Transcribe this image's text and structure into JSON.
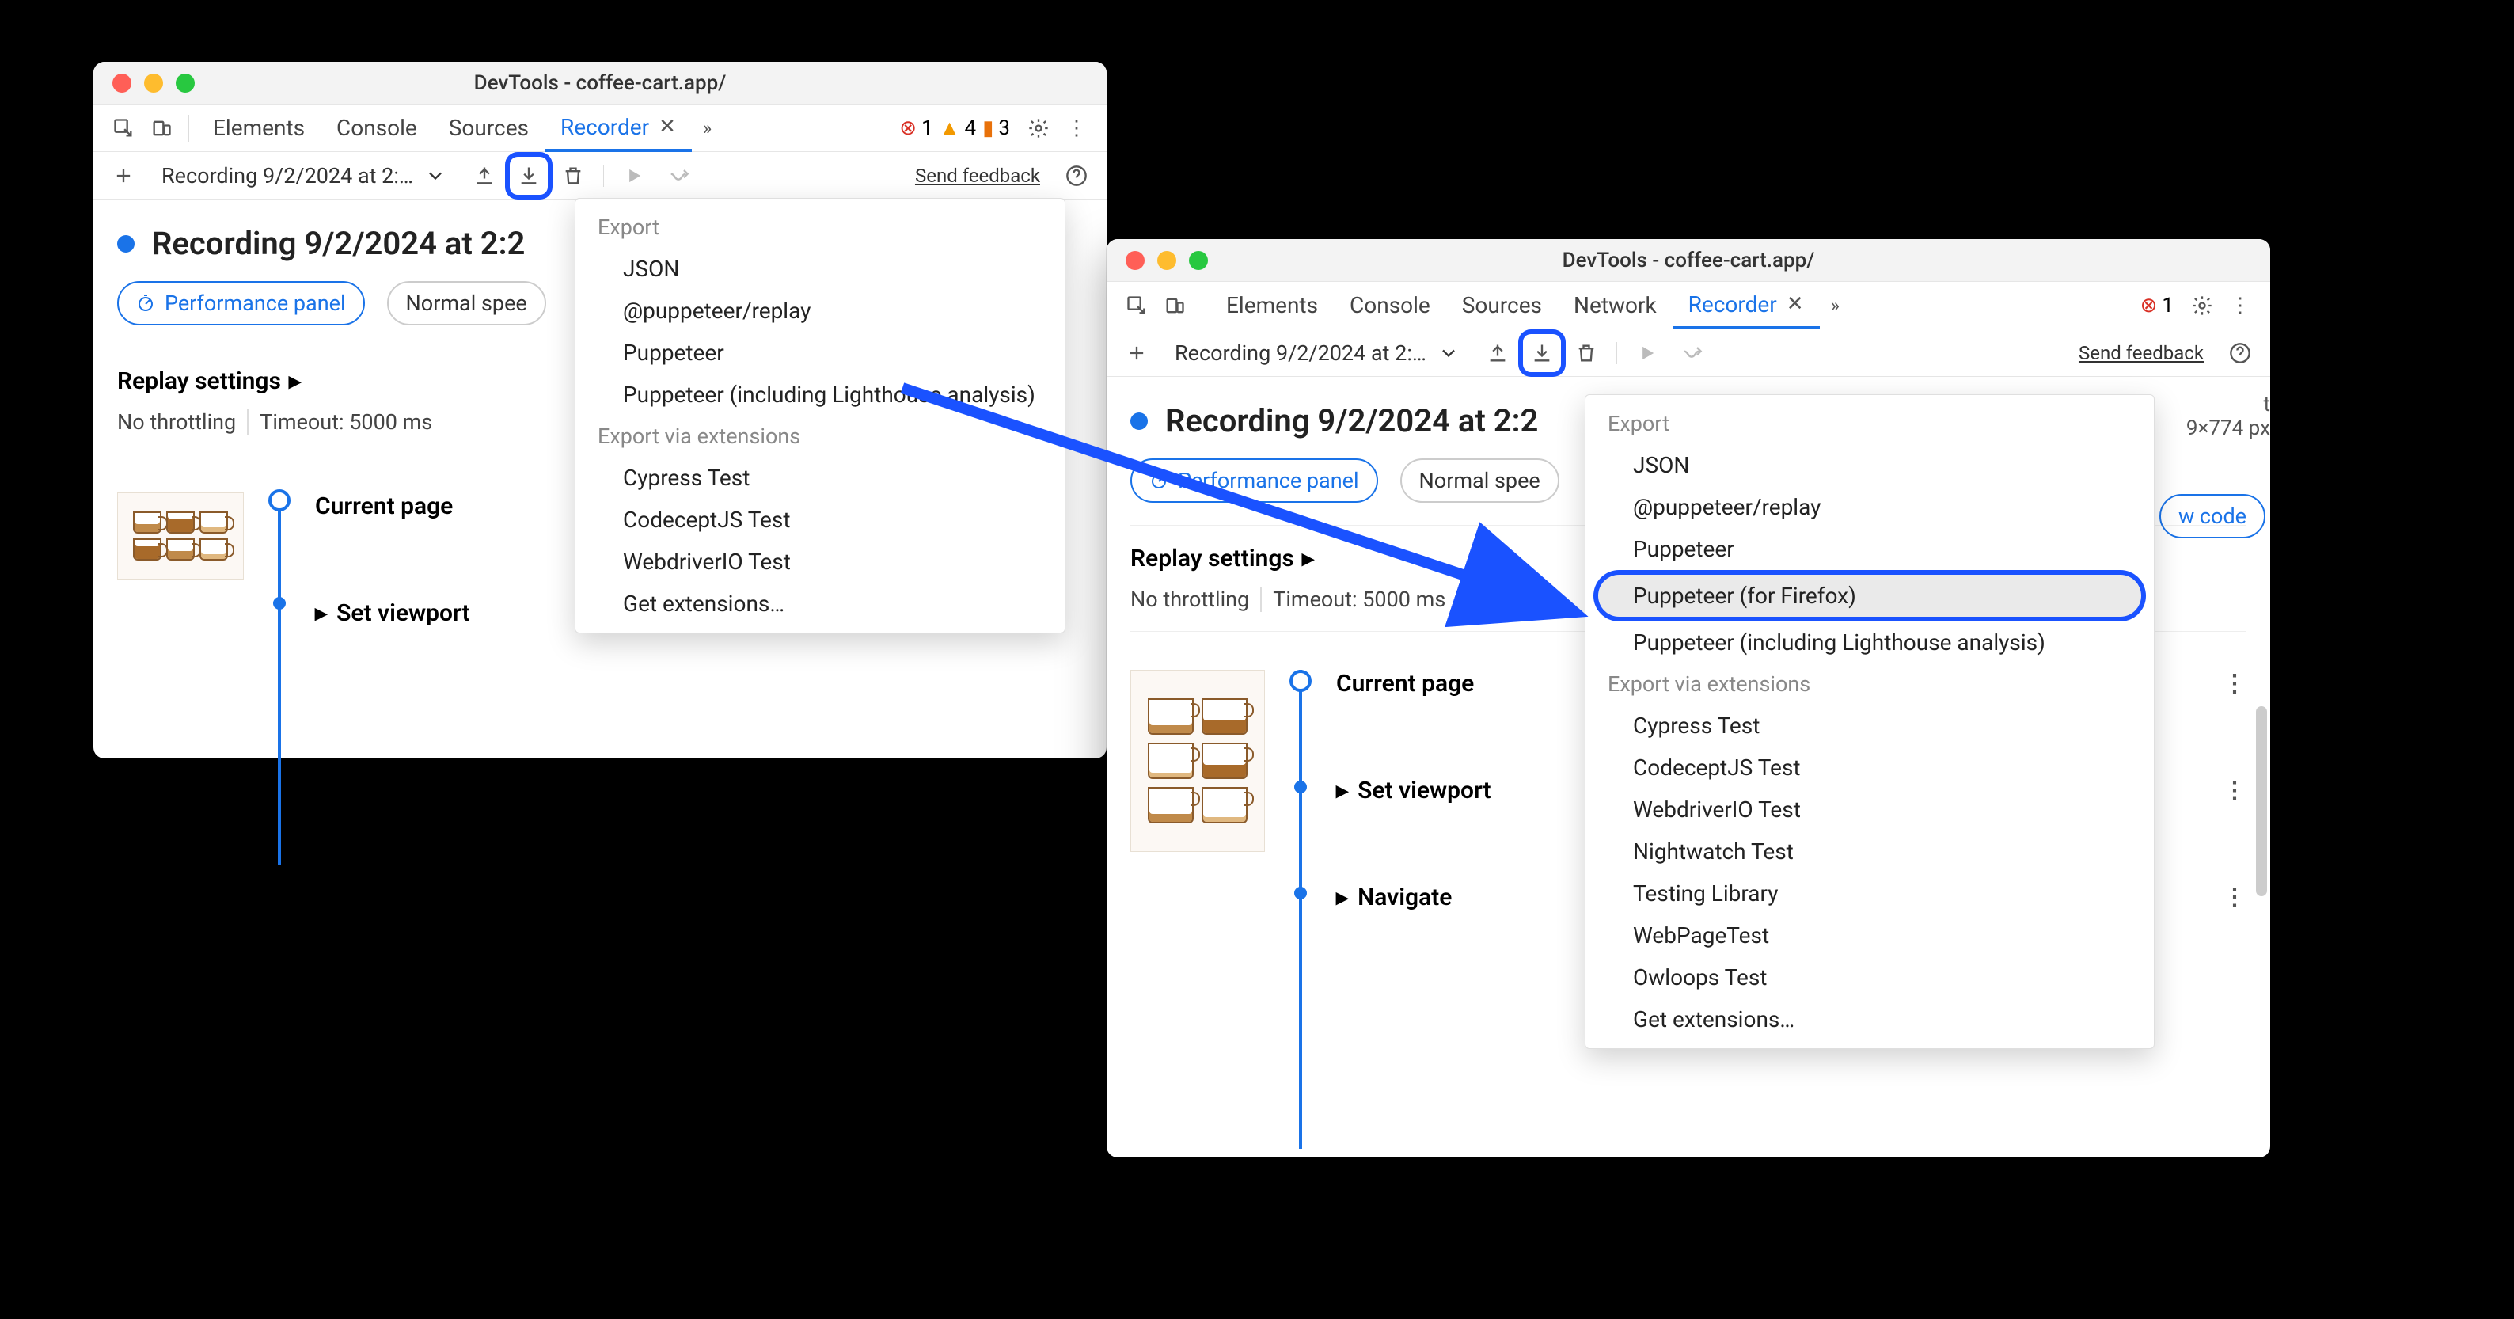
{
  "win1": {
    "title": "DevTools - coffee-cart.app/",
    "tabs": [
      "Elements",
      "Console",
      "Sources",
      "Recorder"
    ],
    "active_tab": "Recorder",
    "stats": {
      "errors": "1",
      "warnings": "4",
      "issues": "3"
    },
    "recording_dropdown": "Recording 9/2/2024 at 2:…",
    "feedback": "Send feedback",
    "rec_title": "Recording 9/2/2024 at 2:2",
    "perf_btn": "Performance panel",
    "speed_btn": "Normal spee",
    "replay_title": "Replay settings",
    "no_throttle": "No throttling",
    "timeout": "Timeout: 5000 ms",
    "step_current": "Current page",
    "step_viewport": "Set viewport",
    "menu": {
      "group1": "Export",
      "items1": [
        "JSON",
        "@puppeteer/replay",
        "Puppeteer",
        "Puppeteer (including Lighthouse analysis)"
      ],
      "group2": "Export via extensions",
      "items2": [
        "Cypress Test",
        "CodeceptJS Test",
        "WebdriverIO Test",
        "Get extensions…"
      ]
    }
  },
  "win2": {
    "title": "DevTools - coffee-cart.app/",
    "tabs": [
      "Elements",
      "Console",
      "Sources",
      "Network",
      "Recorder"
    ],
    "active_tab": "Recorder",
    "stats_errors": "1",
    "recording_dropdown": "Recording 9/2/2024 at 2:…",
    "feedback": "Send feedback",
    "rec_title": "Recording 9/2/2024 at 2:2",
    "perf_btn": "Performance panel",
    "speed_btn": "Normal spee",
    "replay_title": "Replay settings",
    "no_throttle": "No throttling",
    "timeout": "Timeout: 5000 ms",
    "step_current": "Current page",
    "step_viewport": "Set viewport",
    "step_navigate": "Navigate",
    "side_meta_label": "t",
    "side_meta_dim": "9×774 px",
    "show_code": "w code",
    "menu": {
      "group1": "Export",
      "items1": [
        "JSON",
        "@puppeteer/replay",
        "Puppeteer",
        "Puppeteer (for Firefox)",
        "Puppeteer (including Lighthouse analysis)"
      ],
      "highlight_index": 3,
      "group2": "Export via extensions",
      "items2": [
        "Cypress Test",
        "CodeceptJS Test",
        "WebdriverIO Test",
        "Nightwatch Test",
        "Testing Library",
        "WebPageTest",
        "Owloops Test",
        "Get extensions…"
      ]
    }
  }
}
